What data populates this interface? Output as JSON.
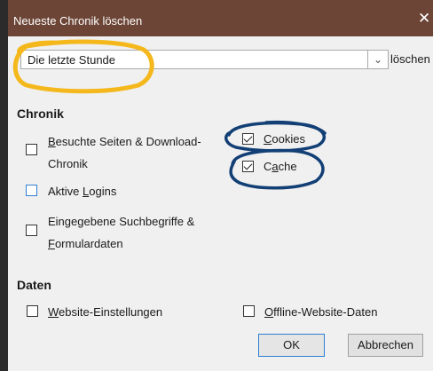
{
  "window": {
    "title": "Neueste Chronik löschen",
    "close_glyph": "✕"
  },
  "time_range": {
    "value": "Die letzte Stunde",
    "dropdown_glyph": "⌄",
    "suffix_label": "löschen"
  },
  "sections": {
    "history": {
      "heading": "Chronik",
      "items": [
        {
          "pre": "",
          "u": "B",
          "post": "esuchte Seiten & Download-",
          "checked": false
        },
        {
          "pre": "",
          "u": "",
          "post": "Chronik"
        },
        {
          "pre": "Aktive ",
          "u": "L",
          "post": "ogins",
          "checked": false
        },
        {
          "pre": "Eingegebene Suchbegriffe &",
          "u": "",
          "post": ""
        },
        {
          "pre": "",
          "u": "F",
          "post": "ormulardaten",
          "checked": false
        },
        {
          "pre": "",
          "u": "C",
          "post": "ookies",
          "checked": true
        },
        {
          "pre": "C",
          "u": "a",
          "post": "che",
          "checked": true
        }
      ]
    },
    "data": {
      "heading": "Daten",
      "items": [
        {
          "pre": "",
          "u": "W",
          "post": "ebsite-Einstellungen",
          "checked": false
        },
        {
          "pre": "",
          "u": "O",
          "post": "ffline-Website-Daten",
          "checked": false
        }
      ]
    }
  },
  "buttons": {
    "ok": "OK",
    "cancel": "Abbrechen"
  },
  "annotation_colors": {
    "yellow": "#f5b81c",
    "blue": "#123f75"
  }
}
